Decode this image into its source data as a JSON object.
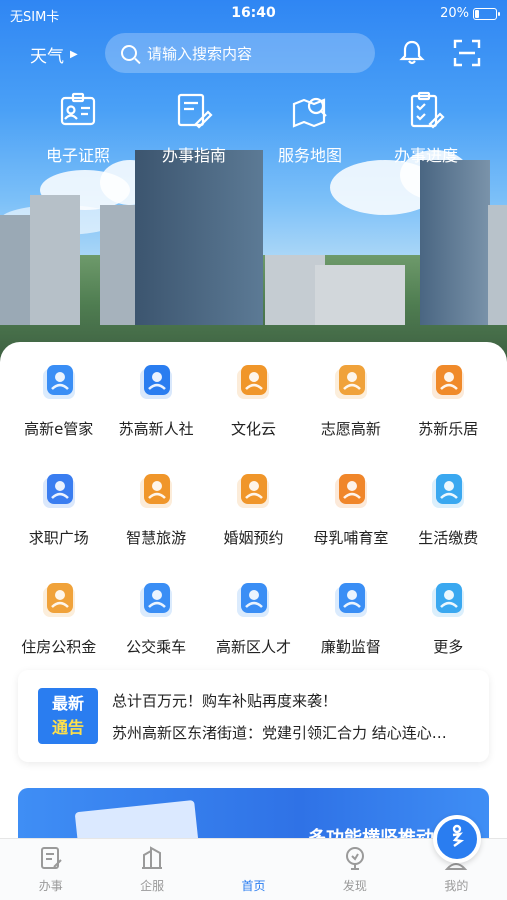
{
  "status_bar": {
    "carrier": "无SIM卡",
    "time": "16:40",
    "battery": "20%",
    "battery_level": 0.2
  },
  "header": {
    "weather_label": "天气",
    "search_placeholder": "请输入搜索内容"
  },
  "quick_services": [
    {
      "label": "电子证照",
      "icon": "id-card-icon"
    },
    {
      "label": "办事指南",
      "icon": "guide-icon"
    },
    {
      "label": "服务地图",
      "icon": "map-search-icon"
    },
    {
      "label": "办事进度",
      "icon": "progress-icon"
    }
  ],
  "services": [
    {
      "label": "高新e管家",
      "icon": "steward-icon",
      "color": "#3a8ef5"
    },
    {
      "label": "苏高新人社",
      "icon": "social-icon",
      "color": "#2a7df0"
    },
    {
      "label": "文化云",
      "icon": "culture-icon",
      "color": "#f0962a"
    },
    {
      "label": "志愿高新",
      "icon": "volunteer-icon",
      "color": "#f0a23a"
    },
    {
      "label": "苏新乐居",
      "icon": "house-icon",
      "color": "#f08a2a"
    },
    {
      "label": "求职广场",
      "icon": "job-icon",
      "color": "#3a7df0"
    },
    {
      "label": "智慧旅游",
      "icon": "cablecar-icon",
      "color": "#f0962a"
    },
    {
      "label": "婚姻预约",
      "icon": "marriage-icon",
      "color": "#f0962a"
    },
    {
      "label": "母乳哺育室",
      "icon": "nursing-icon",
      "color": "#f0862a"
    },
    {
      "label": "生活缴费",
      "icon": "payment-icon",
      "color": "#3aa8f0"
    },
    {
      "label": "住房公积金",
      "icon": "fund-icon",
      "color": "#f0a23a"
    },
    {
      "label": "公交乘车",
      "icon": "bus-icon",
      "color": "#3a8ef5"
    },
    {
      "label": "高新区人才",
      "icon": "talent-icon",
      "color": "#3a8ef5"
    },
    {
      "label": "廉勤监督",
      "icon": "supervision-icon",
      "color": "#3a8ef5"
    },
    {
      "label": "更多",
      "icon": "more-icon",
      "color": "#3aa8f0"
    }
  ],
  "notice": {
    "badge_top": "最新",
    "badge_bottom": "通告",
    "line1": "总计百万元！购车补贴再度来袭！",
    "line2": "苏州高新区东渚街道：党建引领汇合力 结心连心同筑梦"
  },
  "banner": {
    "text": "多功能横竖推动"
  },
  "tabs": [
    {
      "label": "办事",
      "icon": "tasks-icon"
    },
    {
      "label": "企服",
      "icon": "enterprise-icon"
    },
    {
      "label": "首页",
      "icon": "home-icon",
      "active": true
    },
    {
      "label": "发现",
      "icon": "discover-icon"
    },
    {
      "label": "我的",
      "icon": "profile-icon"
    }
  ],
  "colors": {
    "primary": "#2a7df0",
    "accent_orange": "#f0962a"
  }
}
